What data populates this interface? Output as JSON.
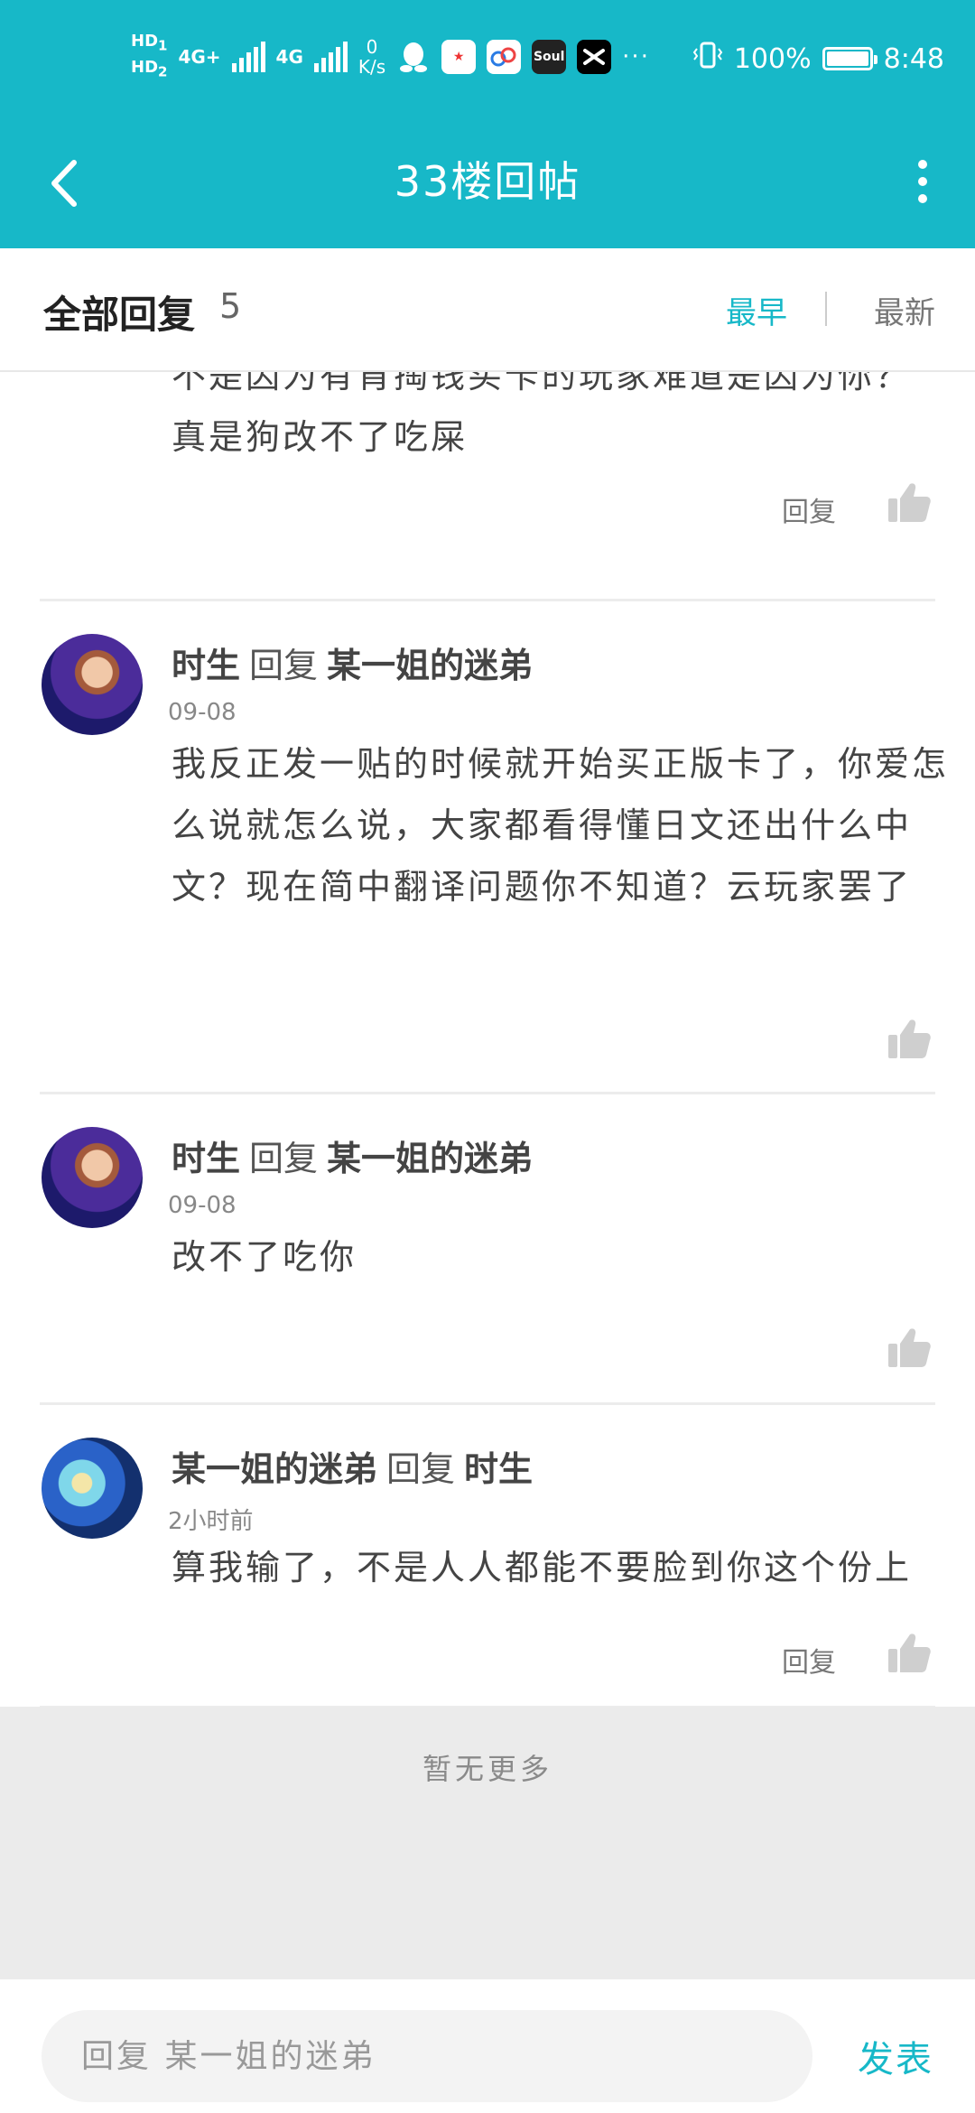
{
  "status_bar": {
    "hd1": "HD",
    "hd1_sim": "1",
    "hd2": "HD",
    "hd2_sim": "2",
    "net1": "4G+",
    "net2": "4G",
    "speed_value": "0",
    "speed_unit": "K/s",
    "app_icons": [
      "qq-icon",
      "weibo-icon",
      "baidu-netdisk-icon",
      "soul-icon",
      "capcut-icon"
    ],
    "soul_label": "Soul",
    "more": "···",
    "battery_percent": "100%",
    "time": "8:48"
  },
  "header": {
    "title": "33楼回帖",
    "background": "#17b8c8"
  },
  "tabs": {
    "all_label": "全部回复",
    "count": "5",
    "earliest_label": "最早",
    "newest_label": "最新",
    "accent": "#17b8c8"
  },
  "replies": [
    {
      "partial": true,
      "body_line1": "不是因为有肯掏钱买卡的玩家难道是因为你？",
      "body_line2": "真是狗改不了吃屎",
      "reply_label": "回复"
    },
    {
      "author": "时生",
      "verb": "回复",
      "target": "某一姐的迷弟",
      "time": "09-08",
      "body": "我反正发一贴的时候就开始买正版卡了，你爱怎么说就怎么说，大家都看得懂日文还出什么中文？现在简中翻译问题你不知道？云玩家罢了"
    },
    {
      "author": "时生",
      "verb": "回复",
      "target": "某一姐的迷弟",
      "time": "09-08",
      "body": "改不了吃你"
    },
    {
      "author": "某一姐的迷弟",
      "verb": "回复",
      "target": "时生",
      "time": "2小时前",
      "body": "算我输了，不是人人都能不要脸到你这个份上",
      "reply_label": "回复"
    }
  ],
  "footer": {
    "no_more": "暂无更多"
  },
  "composer": {
    "placeholder": "回复 某一姐的迷弟",
    "send_label": "发表"
  }
}
